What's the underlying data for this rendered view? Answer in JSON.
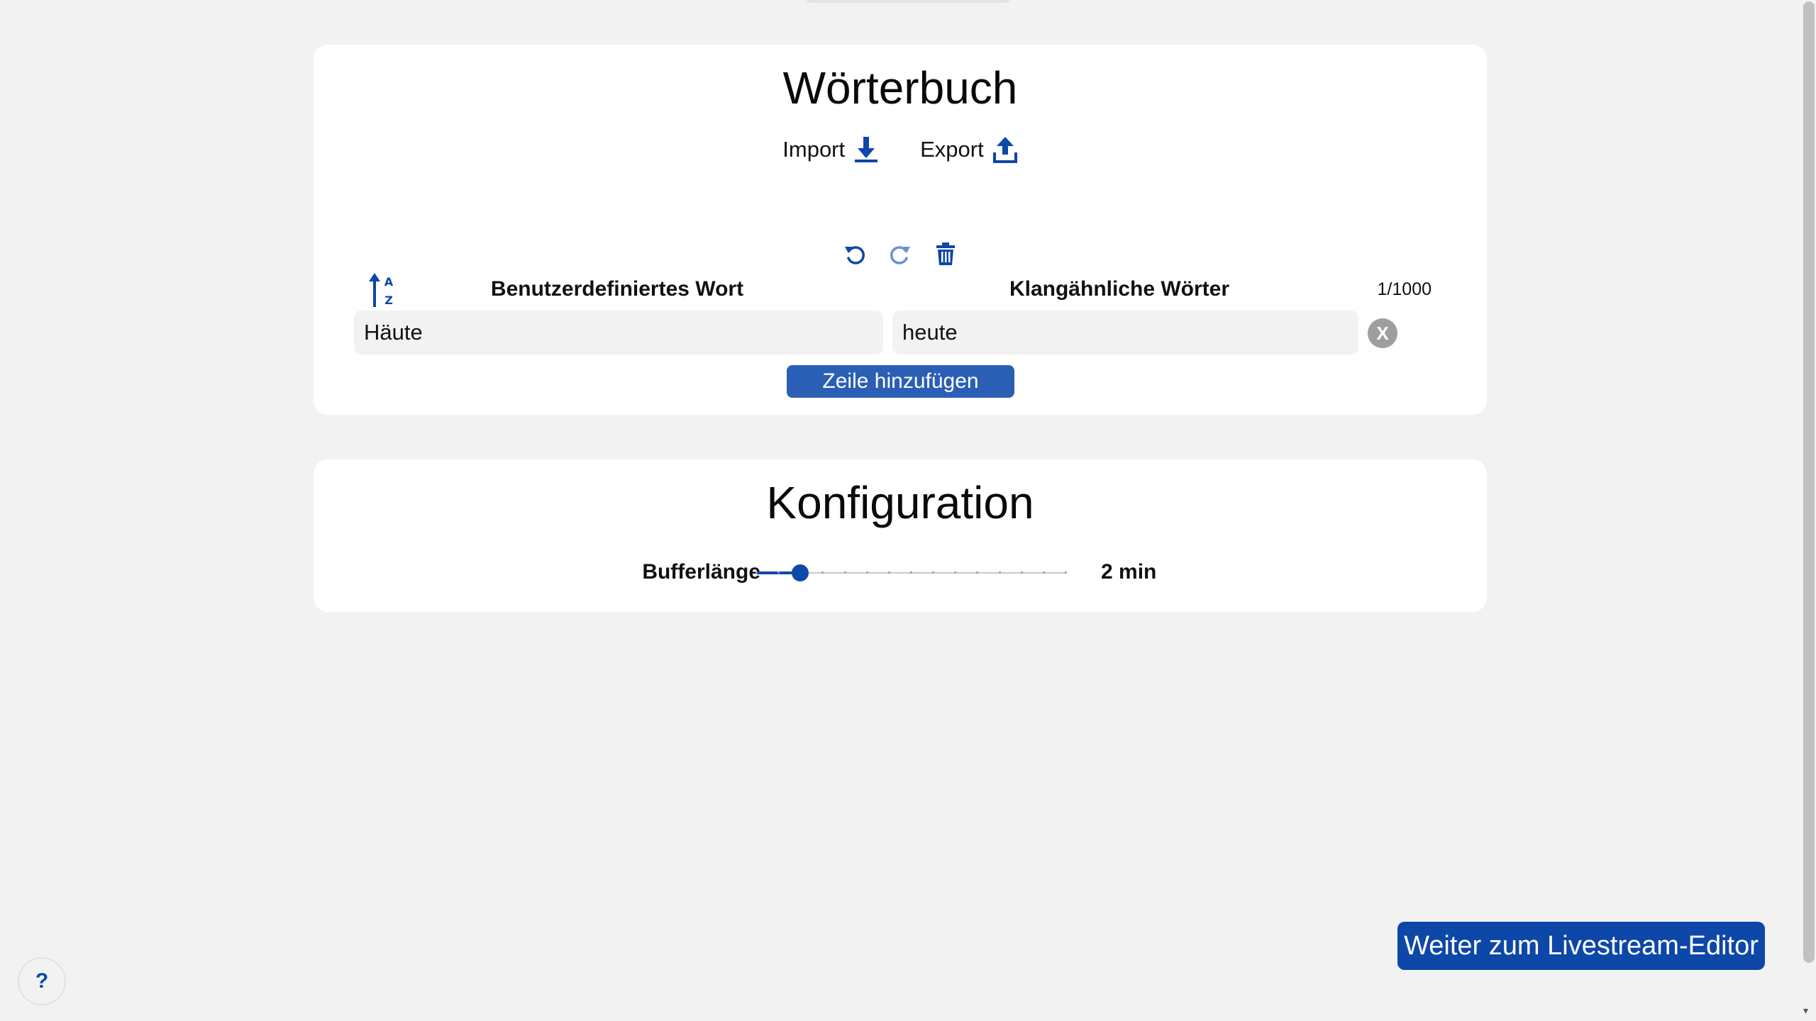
{
  "dictionary": {
    "title": "Wörterbuch",
    "import_label": "Import",
    "export_label": "Export",
    "column_custom_word": "Benutzerdefiniertes Wort",
    "column_sound_alike": "Klangähnliche Wörter",
    "counter": "1/1000",
    "rows": [
      {
        "word": "Häute",
        "sound_alike": "heute"
      }
    ],
    "remove_label": "X",
    "add_row_label": "Zeile hinzufügen"
  },
  "config": {
    "title": "Konfiguration",
    "buffer_label": "Bufferlänge",
    "buffer_value_text": "2 min",
    "buffer_value": 2,
    "buffer_min": 0,
    "buffer_max": 14
  },
  "footer": {
    "next_label": "Weiter zum Livestream-Editor",
    "help_label": "?"
  },
  "colors": {
    "accent": "#0d47a8",
    "add_button": "#2b5fb5",
    "background": "#f2f2f2"
  }
}
